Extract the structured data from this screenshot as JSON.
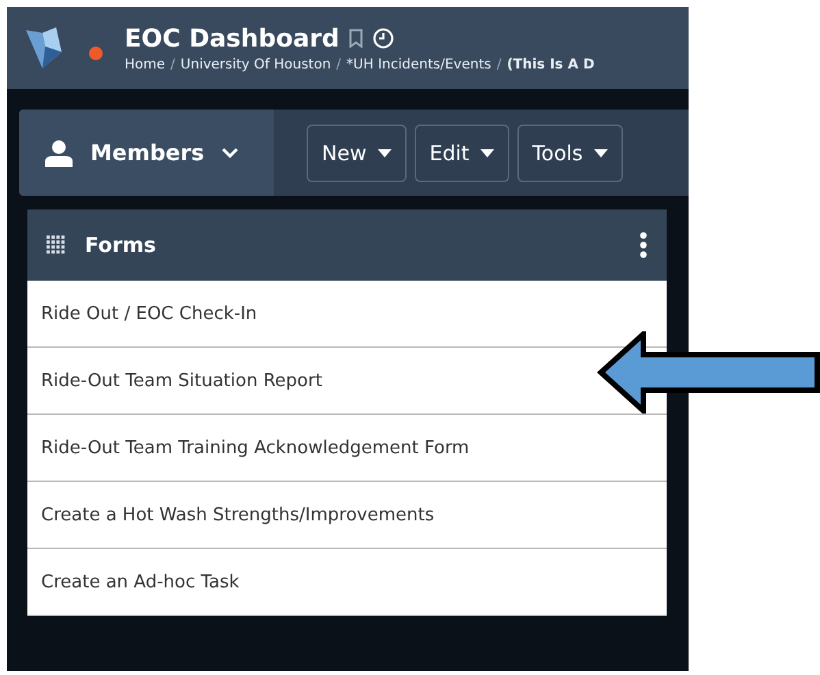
{
  "header": {
    "title": "EOC Dashboard",
    "breadcrumb": [
      "Home",
      "University Of Houston",
      "*UH Incidents/Events",
      "(This Is A D"
    ],
    "breadcrumb_separator": "/"
  },
  "toolbar": {
    "members": "Members",
    "buttons": [
      "New",
      "Edit",
      "Tools"
    ]
  },
  "forms_panel": {
    "title": "Forms",
    "items": [
      {
        "label": "Ride Out / EOC Check-In"
      },
      {
        "label": "Ride-Out Team Situation Report"
      },
      {
        "label": "Ride-Out Team Training Acknowledgement Form"
      },
      {
        "label": "Create a Hot Wash Strengths/Improvements"
      },
      {
        "label": "Create an Ad-hoc Task"
      }
    ]
  }
}
